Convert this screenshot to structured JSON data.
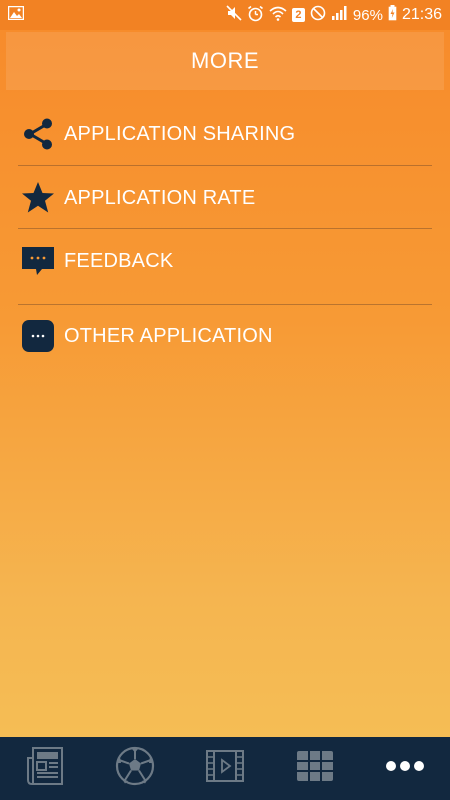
{
  "status_bar": {
    "badge": "2",
    "battery": "96%",
    "time": "21:36"
  },
  "header": {
    "title": "MORE"
  },
  "menu": {
    "items": [
      {
        "label": "APPLICATION SHARING",
        "icon": "share-icon"
      },
      {
        "label": "APPLICATION RATE",
        "icon": "star-icon"
      },
      {
        "label": "FEEDBACK",
        "icon": "feedback-icon"
      },
      {
        "label": "OTHER APPLICATION",
        "icon": "more-apps-icon"
      }
    ]
  },
  "bottom_nav": {
    "items": [
      {
        "icon": "news-icon"
      },
      {
        "icon": "soccer-ball-icon"
      },
      {
        "icon": "video-icon"
      },
      {
        "icon": "table-icon"
      },
      {
        "icon": "more-dots-icon",
        "active": true
      }
    ]
  },
  "colors": {
    "accent_dark": "#12283f",
    "background_top": "#f78a2a",
    "background_bottom": "#f5c157"
  }
}
